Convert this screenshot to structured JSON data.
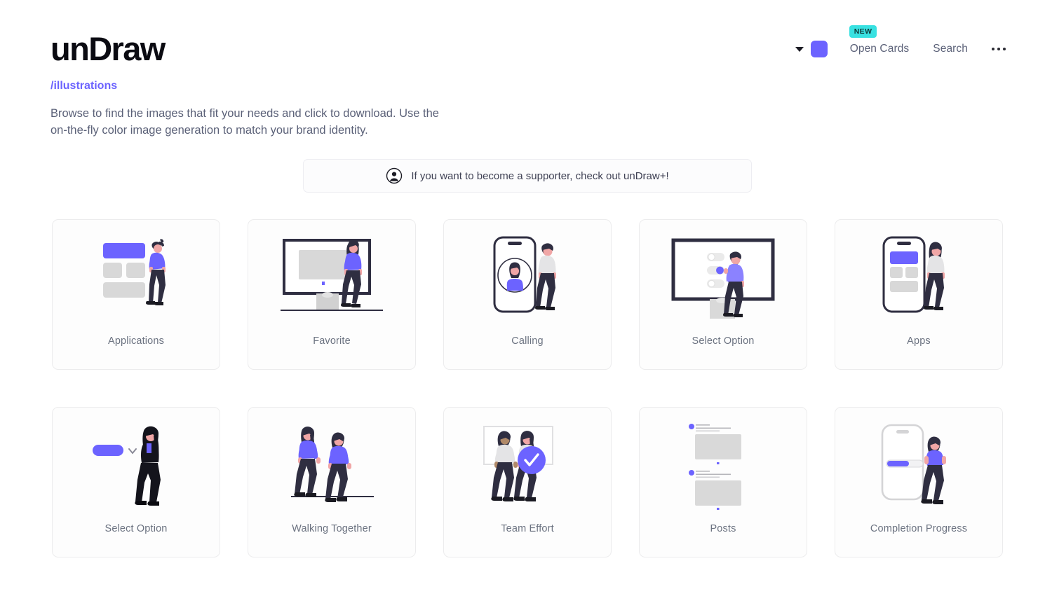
{
  "header": {
    "logo": "unDraw",
    "color_swatch_hex": "#6C63FF",
    "caret_icon": "chevron-down-icon",
    "new_badge": "NEW",
    "nav": [
      {
        "label": "Open Cards",
        "badge": "NEW"
      },
      {
        "label": "Search",
        "badge": null
      }
    ],
    "more_menu_icon": "ellipsis-icon"
  },
  "breadcrumb": "/illustrations",
  "intro": "Browse to find the images that fit your needs and click to download. Use the on-the-fly color image generation to match your brand identity.",
  "supporter": {
    "icon": "avatar-icon",
    "text": "If you want to become a supporter, check out unDraw+!"
  },
  "theme": {
    "accent": "#6C63FF",
    "badge_bg": "#38E1E1",
    "dark": "#2F2E41",
    "gray": "#D8D8D8",
    "text": "#5B6178"
  },
  "illustrations": [
    {
      "label": "Applications",
      "art": "applications"
    },
    {
      "label": "Favorite",
      "art": "favorite"
    },
    {
      "label": "Calling",
      "art": "calling"
    },
    {
      "label": "Select Option",
      "art": "select-option-monitor"
    },
    {
      "label": "Apps",
      "art": "apps"
    },
    {
      "label": "Select Option",
      "art": "select-option-dropdown"
    },
    {
      "label": "Walking Together",
      "art": "walking-together"
    },
    {
      "label": "Team Effort",
      "art": "team-effort"
    },
    {
      "label": "Posts",
      "art": "posts"
    },
    {
      "label": "Completion Progress",
      "art": "completion-progress"
    }
  ]
}
